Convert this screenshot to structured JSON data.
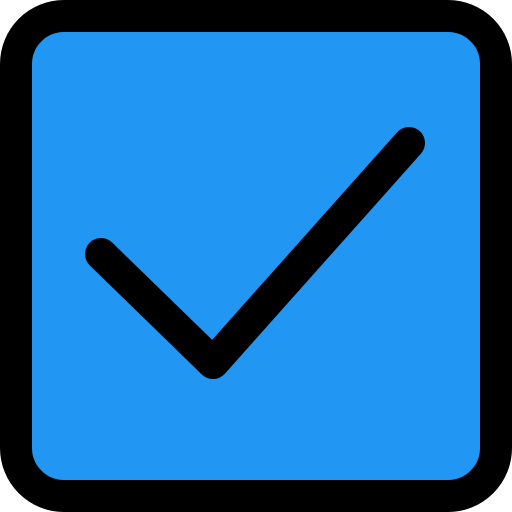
{
  "checkbox": {
    "icon": "checkbox-checked-icon",
    "state": "checked",
    "colors": {
      "fill": "#2196F3",
      "stroke": "#000000",
      "background": "#FFFFFF"
    }
  }
}
